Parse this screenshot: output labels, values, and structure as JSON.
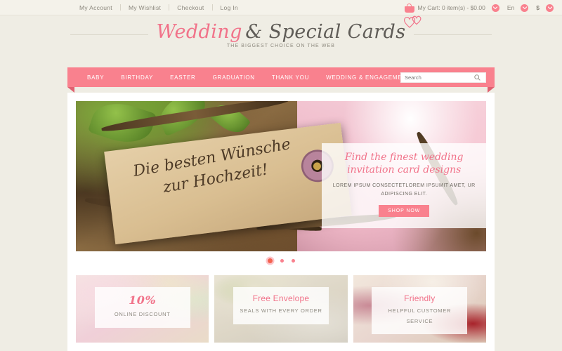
{
  "topbar": {
    "links": [
      {
        "label": "My Account"
      },
      {
        "label": "My Wishlist"
      },
      {
        "label": "Checkout"
      },
      {
        "label": "Log In"
      }
    ],
    "cart_label": "My Cart: 0 item(s) - $0.00",
    "language": "En",
    "currency": "$"
  },
  "logo": {
    "word_pink": "Wedding",
    "word_dark": "& Special Cards",
    "tagline": "THE BIGGEST  CHOICE ON THE WEB"
  },
  "nav": {
    "items": [
      {
        "label": "BABY"
      },
      {
        "label": "BIRTHDAY"
      },
      {
        "label": "EASTER"
      },
      {
        "label": "GRADUATION"
      },
      {
        "label": "THANK YOU"
      },
      {
        "label": "WEDDING & ENGAGEMENT"
      }
    ]
  },
  "search": {
    "placeholder": "Search",
    "value": ""
  },
  "hero": {
    "tag_text": "Die besten Wünsche zur Hochzeit!",
    "heading": "Find the finest wedding invitation card designs",
    "body": "LOREM IPSUM CONSECTETLOREM IPSUMIT AMET, UR ADIPISCING ELIT.",
    "button": "SHOP NOW",
    "slides": [
      {
        "active": true
      },
      {
        "active": false
      },
      {
        "active": false
      }
    ]
  },
  "tiles": [
    {
      "title": "10%",
      "subtitle": "ONLINE DISCOUNT"
    },
    {
      "title": "Free Envelope",
      "subtitle": "SEALS WITH EVERY ORDER"
    },
    {
      "title": "Friendly",
      "subtitle": "HELPFUL CUSTOMER SERVICE"
    }
  ],
  "colors": {
    "accent_pink": "#F9818E",
    "logo_pink": "#F1738A",
    "page_bg": "#EFEDE4"
  }
}
